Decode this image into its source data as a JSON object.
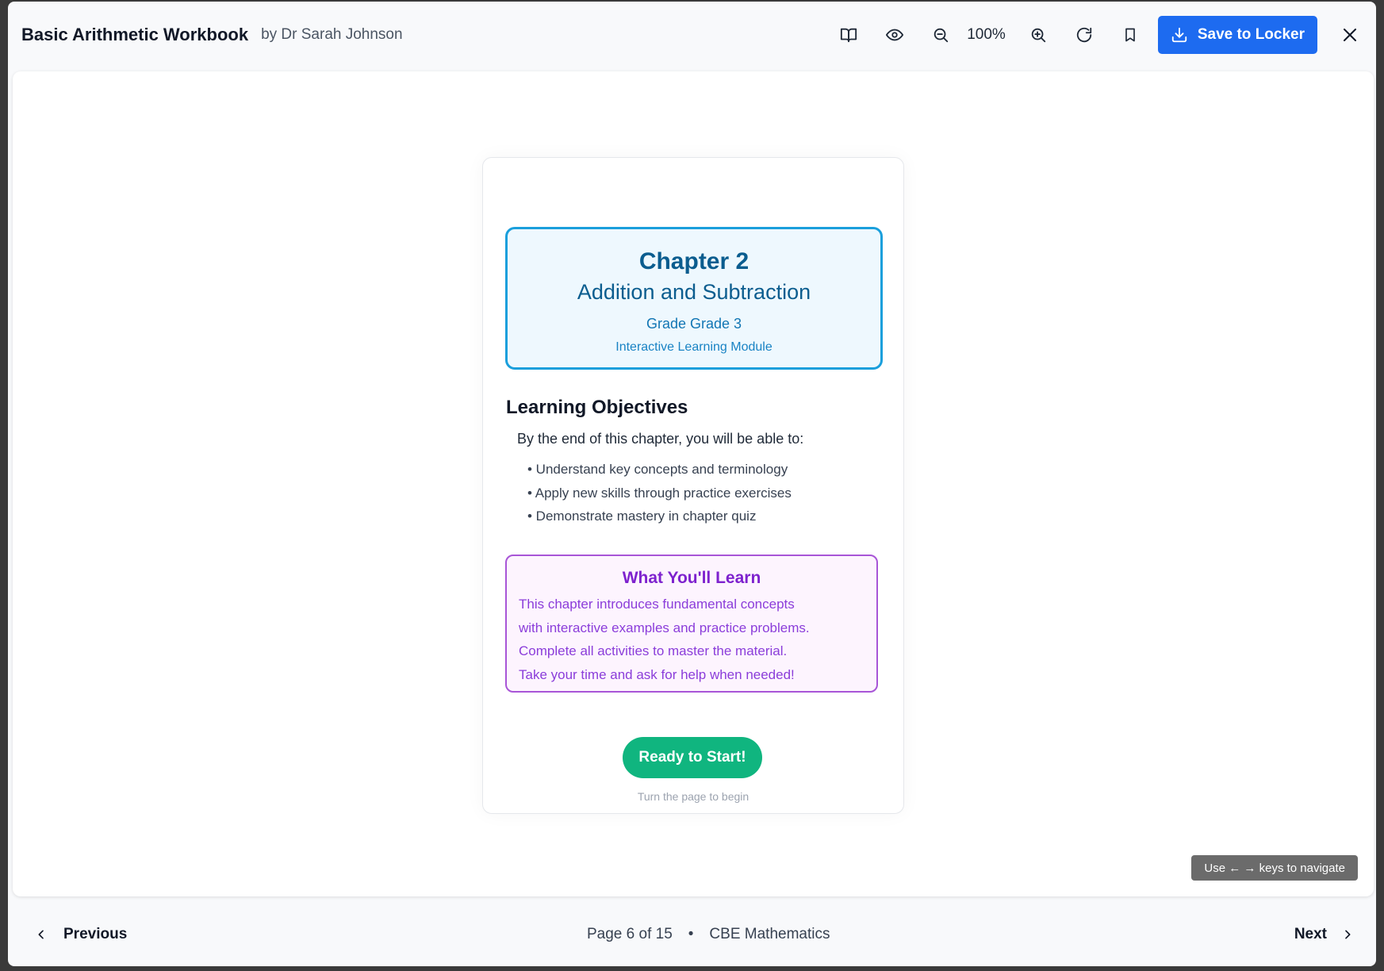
{
  "header": {
    "title": "Basic Arithmetic Workbook",
    "author": "by Dr Sarah Johnson",
    "zoom": "100%",
    "save_label": "Save to Locker",
    "icons": [
      "book-open-icon",
      "eye-icon",
      "zoom-out-icon",
      "zoom-in-icon",
      "rotate-icon",
      "bookmark-icon",
      "download-icon",
      "close-icon"
    ],
    "accent_color": "#1d6bf0"
  },
  "page": {
    "chapter_number": "Chapter 2",
    "chapter_title": "Addition and Subtraction",
    "grade": "Grade Grade 3",
    "module": "Interactive Learning Module",
    "objectives_heading": "Learning Objectives",
    "objectives_intro": "By the end of this chapter, you will be able to:",
    "objectives": [
      "• Understand key concepts and terminology",
      "• Apply new skills through practice exercises",
      "• Demonstrate mastery in chapter quiz"
    ],
    "learn_title": "What You'll Learn",
    "learn_lines": [
      "This chapter introduces fundamental concepts",
      "with interactive examples and practice problems.",
      "Complete all activities to master the material.",
      "Take your time and ask for help when needed!"
    ],
    "start_button": "Ready to Start!",
    "hint": "Turn the page to begin"
  },
  "keyboard_hint": "Use ← → keys to navigate",
  "footer": {
    "previous": "Previous",
    "next": "Next",
    "page_indicator": "Page 6 of 15",
    "separator": "•",
    "subject": "CBE Mathematics"
  }
}
